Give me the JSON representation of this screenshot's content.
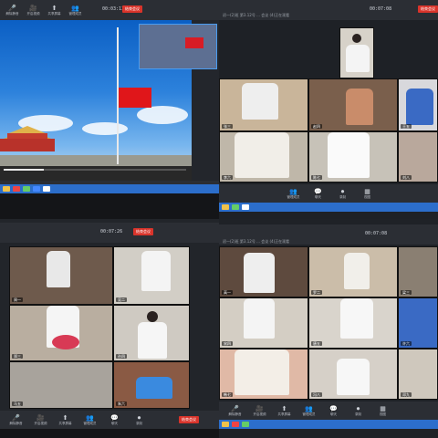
{
  "toolbar": {
    "items": [
      {
        "glyph": "🎤",
        "label": "解除静音"
      },
      {
        "glyph": "🎥",
        "label": "开启视频"
      },
      {
        "glyph": "⬆",
        "label": "共享屏幕"
      },
      {
        "glyph": "👥",
        "label": "管理成员"
      },
      {
        "glyph": "💬",
        "label": "聊天"
      },
      {
        "glyph": "⏺",
        "label": "录制"
      },
      {
        "glyph": "▦",
        "label": "视图"
      }
    ],
    "end_label": "结束会议"
  },
  "quadrants": [
    {
      "time": "00:03:13",
      "title": ""
    },
    {
      "time": "00:07:08",
      "title": "初一(2)班 第3.12号 ... 会议 (4)正在观看"
    },
    {
      "time": "00:07:26",
      "title": ""
    },
    {
      "time": "00:07:08",
      "title": "初一(2)班 第3.12号 ... 会议 (4)正在观看"
    }
  ],
  "participants": {
    "q2": [
      "张三",
      "赵四",
      "王五",
      "李六",
      "陈七",
      "刘八",
      "杨九",
      "黄十"
    ],
    "q3": [
      "周一",
      "吴二",
      "郑三",
      "孙四",
      "马五",
      "朱六",
      "胡七",
      "林八",
      "何九"
    ],
    "q4": [
      "高一",
      "罗二",
      "梁三",
      "宋四",
      "唐五",
      "许六",
      "韩七",
      "冯八",
      "邓九"
    ]
  },
  "colors": {
    "end_button": "#d9342b",
    "flag_red": "#e0161a",
    "taskbar": "#2c6ecb",
    "toolbar_bg": "#2b2e34"
  }
}
